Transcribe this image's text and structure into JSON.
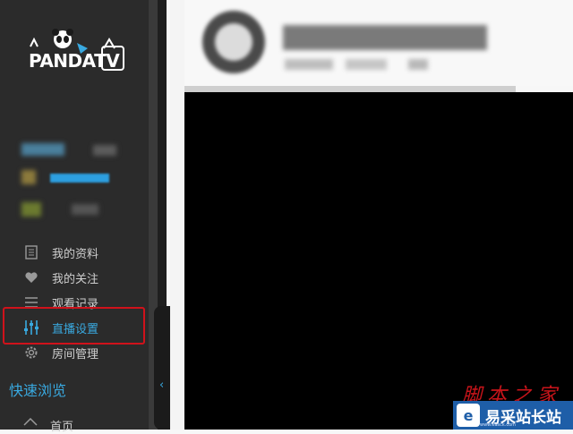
{
  "brand": {
    "logo_text": "PANDA",
    "logo_tv": "TV"
  },
  "sidebar": {
    "items": [
      {
        "label": "我的资料",
        "icon": "profile-icon"
      },
      {
        "label": "我的关注",
        "icon": "heart-icon"
      },
      {
        "label": "观看记录",
        "icon": "list-icon"
      },
      {
        "label": "直播设置",
        "icon": "sliders-icon"
      },
      {
        "label": "房间管理",
        "icon": "gear-icon"
      }
    ],
    "active_index": 3,
    "section_title": "快速浏览",
    "last_item": {
      "label": "首页",
      "icon": "home-icon"
    }
  },
  "watermark": {
    "cn": "脚本之家",
    "badge_text": "易采站长站",
    "badge_url": "www.easck.com",
    "badge_mark": "e"
  },
  "colors": {
    "accent": "#39a9e0",
    "highlight": "#d0121b",
    "sidebar": "#2b2b2b"
  }
}
